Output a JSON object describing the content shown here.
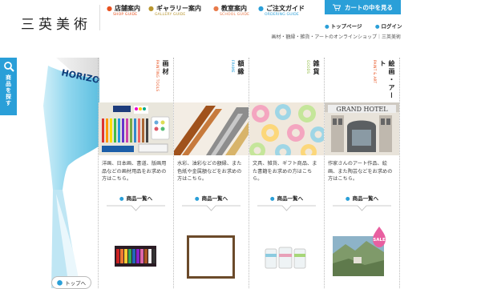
{
  "brand": {
    "logo": "三英美術"
  },
  "nav": [
    {
      "label": "店舗案内",
      "sub": "SHOP GUIDE",
      "color": "#e8511f"
    },
    {
      "label": "ギャラリー案内",
      "sub": "GALLERY GUIDE",
      "color": "#b8962e"
    },
    {
      "label": "教室案内",
      "sub": "SCHOOL GUIDE",
      "color": "#e87a4a"
    },
    {
      "label": "ご注文ガイド",
      "sub": "ORDERING GUIDE",
      "color": "#2a9fd8"
    }
  ],
  "cart": {
    "label": "カートの中を見る"
  },
  "sublinks": {
    "top": "トップページ",
    "login": "ログイン"
  },
  "tagline": "画材・額縁・雑貨・アートのオンラインショップ｜三英美術",
  "side_tab": {
    "label": "商品を探す"
  },
  "tube_brand": "HORIZON",
  "categories": [
    {
      "jp": "画材",
      "en": "PAINTING TOOLS",
      "en_color": "#e8511f",
      "desc": "洋画、日本画、書道、版画用品などの画材用品をお求めの方はこちら。",
      "button": "商品一覧へ"
    },
    {
      "jp": "額縁",
      "en": "FRAME",
      "en_color": "#2a9fd8",
      "desc": "水彩、油彩などの額縁、また色紙や金属額などをお求めの方はこちら。",
      "button": "商品一覧へ"
    },
    {
      "jp": "雑貨",
      "en": "GOODS",
      "en_color": "#8bb83a",
      "desc": "文具、雑貨、ギフト商品、また書籍をお求めの方はこちら。",
      "button": "商品一覧へ"
    },
    {
      "jp": "絵画・アート",
      "en": "PAINT & ART",
      "en_color": "#e8511f",
      "desc": "作家さんのアート作品、絵画、また陶芸などをお求めの方はこちら。",
      "button": "商品一覧へ",
      "sale": "SALE",
      "photo_sign": "GRAND HOTEL"
    }
  ],
  "to_top": "トップへ",
  "colors": {
    "accent": "#2a9fd8",
    "sale": "#e85fa0"
  }
}
